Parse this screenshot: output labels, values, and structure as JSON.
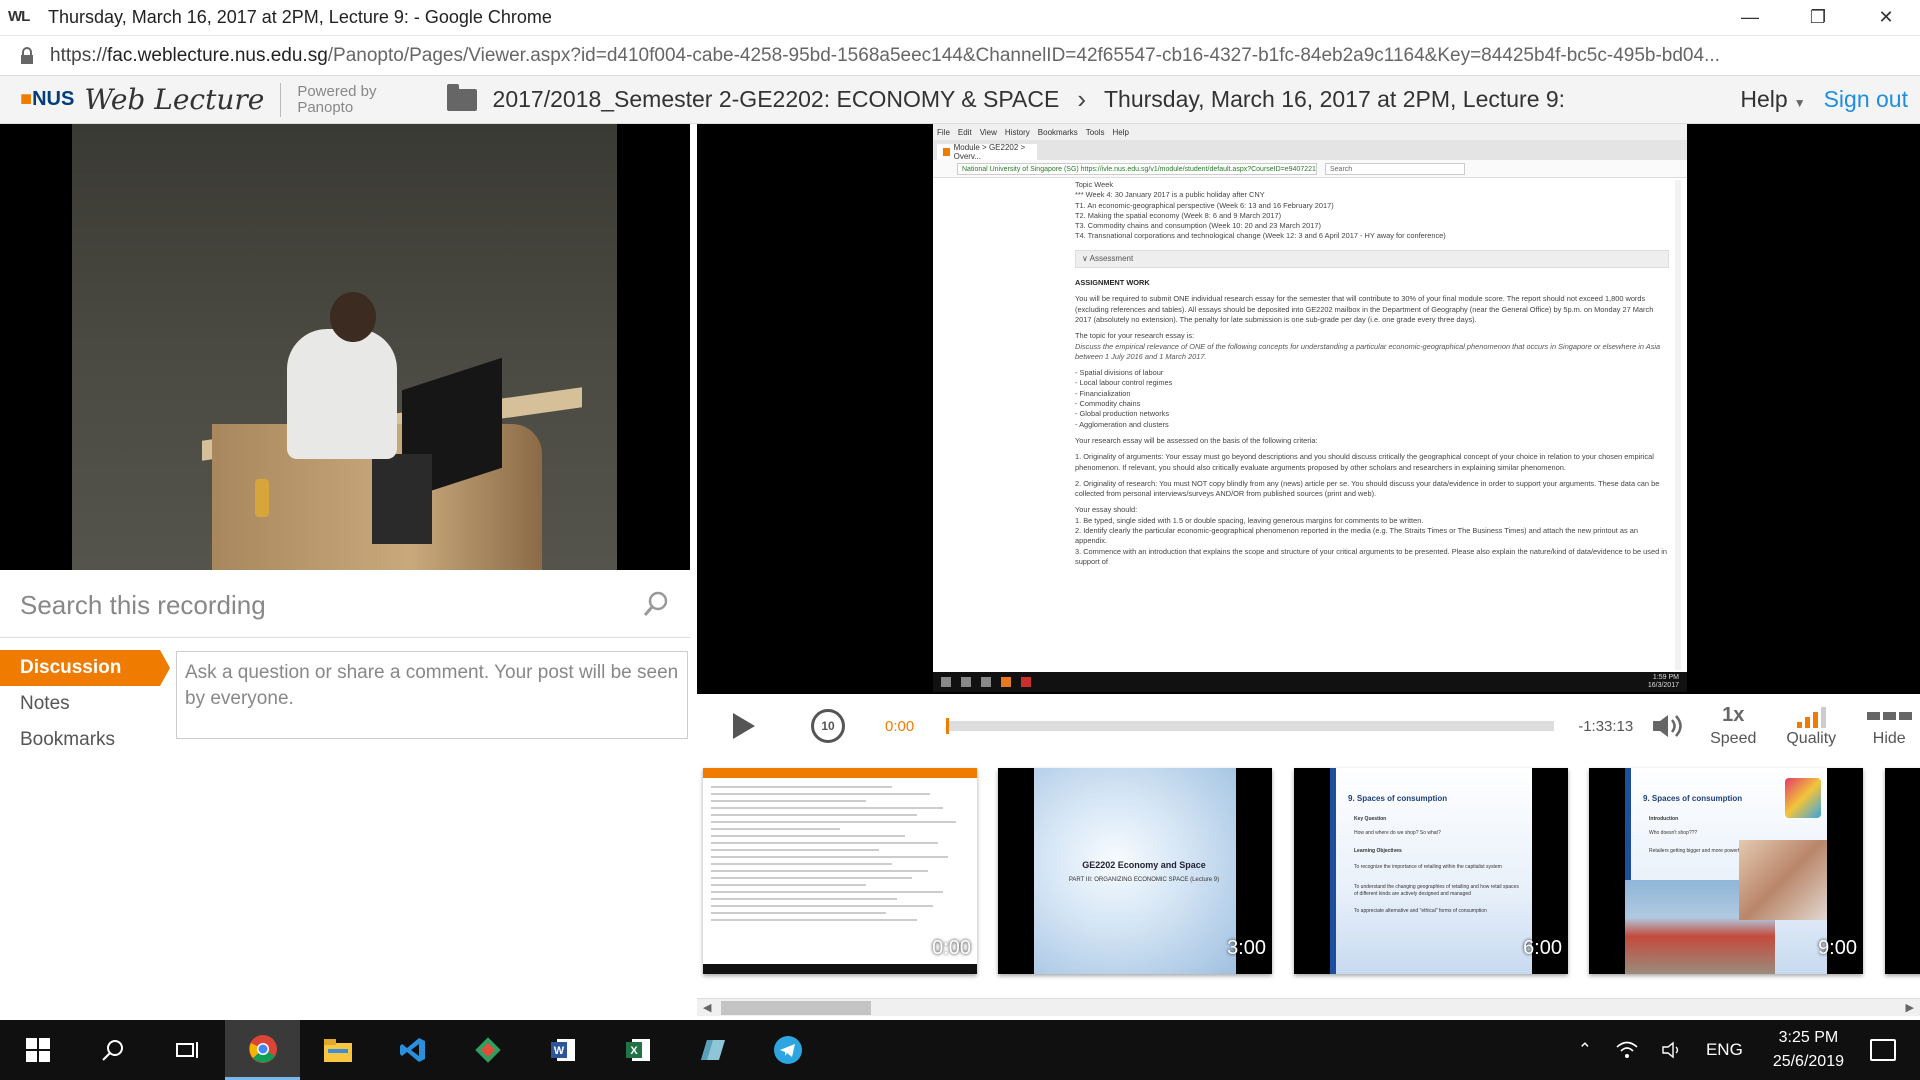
{
  "window": {
    "title": "Thursday, March 16, 2017 at 2PM, Lecture 9: - Google Chrome",
    "app_icon_text": "WL",
    "controls": [
      "minimize",
      "maximize",
      "close"
    ]
  },
  "address_bar": {
    "scheme": "https://",
    "host": "fac.weblecture.nus.edu.sg",
    "path": "/Panopto/Pages/Viewer.aspx?id=d410f004-cabe-4258-95bd-1568a5eec144&ChannelID=42f65547-cb16-4327-b1fc-84eb2a9c1164&Key=84425b4f-bc5c-495b-bd04..."
  },
  "header": {
    "logo_nus": "NUS",
    "logo_weblecture": "Web Lecture",
    "powered_by_line1": "Powered by",
    "powered_by_line2": "Panopto",
    "breadcrumb_folder": "2017/2018_Semester 2-GE2202: ECONOMY & SPACE",
    "breadcrumb_session": "Thursday, March 16, 2017 at 2PM, Lecture 9:",
    "help_label": "Help",
    "signout_label": "Sign out"
  },
  "sidebar": {
    "search_placeholder": "Search this recording",
    "tabs": [
      {
        "label": "Discussion",
        "active": true
      },
      {
        "label": "Notes",
        "active": false
      },
      {
        "label": "Bookmarks",
        "active": false
      }
    ],
    "comment_placeholder": "Ask a question or share a comment. Your post will be seen by everyone."
  },
  "slide_screen": {
    "menu": [
      "File",
      "Edit",
      "View",
      "History",
      "Bookmarks",
      "Tools",
      "Help"
    ],
    "tab_title": "Module > GE2202 > Overv...",
    "url": "National University of Singapore (SG)  https://ivle.nus.edu.sg/v1/module/student/default.aspx?CourseID=e9407221-fb70-4d5a-88ad-0430f6a8c33d",
    "search_placeholder": "Search",
    "topic_lines": [
      "Topic Week",
      "*** Week 4: 30 January 2017 is a public holiday after CNY",
      "T1. An economic-geographical perspective (Week 6: 13 and 16 February 2017)",
      "T2. Making the spatial economy (Week 8: 6 and 9 March 2017)",
      "T3. Commodity chains and consumption (Week 10: 20 and 23 March 2017)",
      "T4. Transnational corporations and technological change (Week 12: 3 and 6 April 2017 - HY away for conference)"
    ],
    "assessment_label": "Assessment",
    "assignment_heading": "ASSIGNMENT WORK",
    "assignment_text": "You will be required to submit ONE individual research essay for the semester that will contribute to 30% of your final module score. The report should not exceed 1,800 words (excluding references and tables). All essays should be deposited into GE2202 mailbox in the Department of Geography (near the General Office) by 5p.m. on Monday 27 March 2017 (absolutely no extension). The penalty for late submission is one sub-grade per day (i.e. one grade every three days).",
    "topic_intro": "The topic for your research essay is:",
    "topic_question": "Discuss the empirical relevance of ONE of the following concepts for understanding a particular economic-geographical phenomenon that occurs in Singapore or elsewhere in Asia between 1 July 2016 and 1 March 2017.",
    "concepts": [
      "- Spatial divisions of labour",
      "- Local labour control regimes",
      "- Financialization",
      "- Commodity chains",
      "- Global production networks",
      "- Agglomeration and clusters"
    ],
    "criteria_intro": "Your research essay will be assessed on the basis of the following criteria:",
    "criteria_1": "1. Originality of arguments: Your essay must go beyond descriptions and you should discuss critically the geographical concept of your choice in relation to your chosen empirical phenomenon. If relevant, you should also critically evaluate arguments proposed by other scholars and researchers in explaining similar phenomenon.",
    "criteria_2": "2. Originality of research: You must NOT copy blindly from any (news) article per se. You should discuss your data/evidence in order to support your arguments. These data can be collected from personal interviews/surveys AND/OR from published sources (print and web).",
    "essay_intro": "Your essay should:",
    "essay_points": [
      "1. Be typed, single sided with 1.5 or double spacing, leaving generous margins for comments to be written.",
      "2. Identify clearly the particular economic-geographical phenomenon reported in the media (e.g. The Straits Times or The Business Times) and attach the new printout as an appendix.",
      "3. Commence with an introduction that explains the scope and structure of your critical arguments to be presented. Please also explain the nature/kind of data/evidence to be used in support of"
    ],
    "clock_time": "1:59 PM",
    "clock_date": "16/3/2017"
  },
  "player": {
    "current_time": "0:00",
    "remaining_time": "-1:33:13",
    "progress_fraction": 0.0,
    "speed_value": "1x",
    "speed_label": "Speed",
    "quality_label": "Quality",
    "hide_label": "Hide"
  },
  "thumbnails": [
    {
      "time": "0:00",
      "kind": "screen"
    },
    {
      "time": "3:00",
      "kind": "title",
      "title": "GE2202 Economy and Space",
      "subtitle": "PART III: ORGANIZING ECONOMIC SPACE (Lecture 9)"
    },
    {
      "time": "6:00",
      "kind": "objectives",
      "title": "9. Spaces of consumption",
      "lines": [
        "Key Question",
        "How and where do we shop? So what?",
        "Learning Objectives",
        "To recognize the importance of retailing within the capitalist system",
        "To understand the changing geographies of retailing and how retail spaces of different kinds are actively designed and managed",
        "To appreciate alternative and \"ethical\" forms of consumption"
      ]
    },
    {
      "time": "9:00",
      "kind": "intro",
      "title": "9. Spaces of consumption",
      "lines": [
        "Introduction",
        "Who doesn't shop???",
        "Retailers getting bigger and more powerful"
      ]
    }
  ],
  "taskbar": {
    "icons": [
      "start-icon",
      "search-icon",
      "task-view-icon",
      "chrome-icon",
      "file-explorer-icon",
      "vscode-icon",
      "git-icon",
      "word-icon",
      "excel-icon",
      "app-icon",
      "telegram-icon"
    ],
    "language": "ENG",
    "time": "3:25 PM",
    "date": "25/6/2019"
  },
  "colors": {
    "accent_orange": "#ef7c00",
    "link_blue": "#1e8fe0",
    "nus_blue": "#003d7c"
  }
}
